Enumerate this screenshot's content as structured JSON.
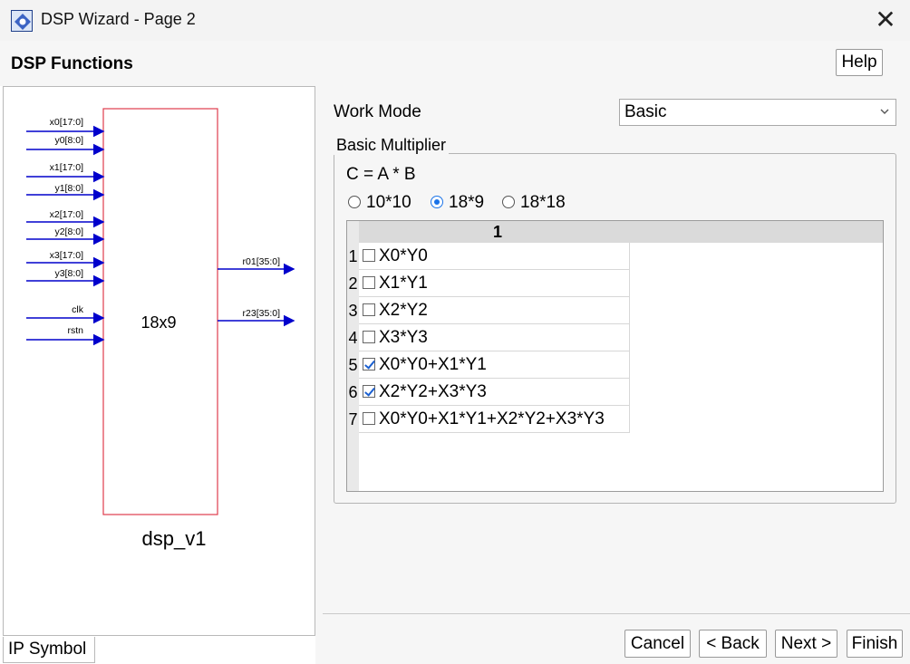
{
  "window": {
    "title": "DSP Wizard - Page 2",
    "icon": "dsp-app-icon",
    "close_glyph": "✕"
  },
  "header": {
    "section_title": "DSP Functions",
    "help_label": "Help"
  },
  "symbol": {
    "tab_label": "IP Symbol",
    "block_label": "18x9",
    "module_name": "dsp_v1",
    "inputs": [
      "x0[17:0]",
      "y0[8:0]",
      "x1[17:0]",
      "y1[8:0]",
      "x2[17:0]",
      "y2[8:0]",
      "x3[17:0]",
      "y3[8:0]",
      "clk",
      "rstn"
    ],
    "outputs": [
      "r01[35:0]",
      "r23[35:0]"
    ],
    "colors": {
      "block_border": "#e03c4c",
      "arrow": "#0000cc"
    }
  },
  "config": {
    "work_mode_label": "Work Mode",
    "work_mode_value": "Basic",
    "group_title": "Basic Multiplier",
    "formula": "C  = A * B",
    "radios": [
      {
        "label": "10*10",
        "selected": false
      },
      {
        "label": "18*9",
        "selected": true
      },
      {
        "label": "18*18",
        "selected": false
      }
    ],
    "table": {
      "column_header": "1",
      "rows": [
        {
          "num": "1",
          "label": "X0*Y0",
          "checked": false
        },
        {
          "num": "2",
          "label": "X1*Y1",
          "checked": false
        },
        {
          "num": "3",
          "label": "X2*Y2",
          "checked": false
        },
        {
          "num": "4",
          "label": "X3*Y3",
          "checked": false
        },
        {
          "num": "5",
          "label": "X0*Y0+X1*Y1",
          "checked": true
        },
        {
          "num": "6",
          "label": "X2*Y2+X3*Y3",
          "checked": true
        },
        {
          "num": "7",
          "label": "X0*Y0+X1*Y1+X2*Y2+X3*Y3",
          "checked": false
        }
      ]
    }
  },
  "footer": {
    "cancel_label": "Cancel",
    "back_label": "< Back",
    "next_label": "Next >",
    "finish_label": "Finish"
  }
}
